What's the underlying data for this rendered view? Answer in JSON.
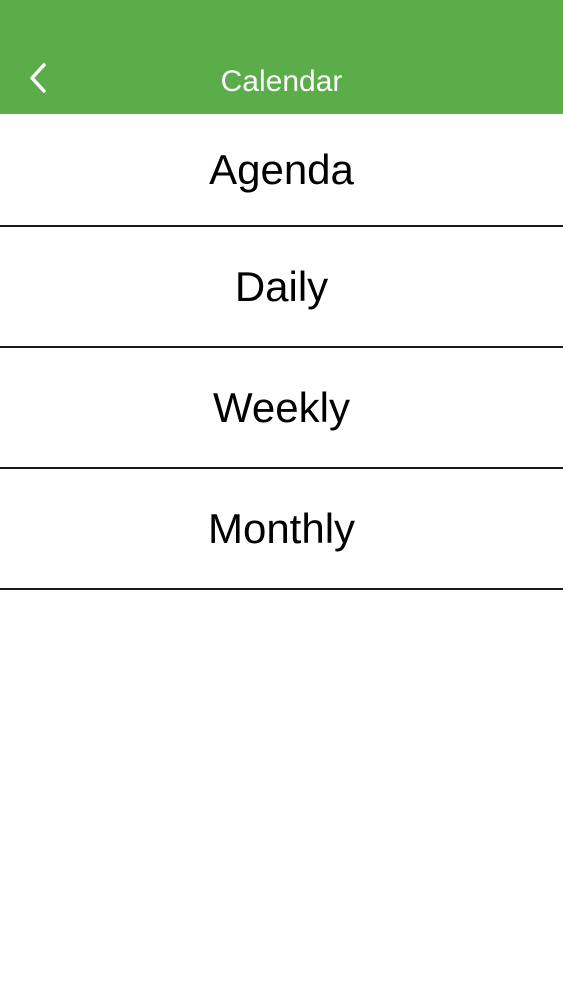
{
  "header": {
    "title": "Calendar",
    "back_icon": "chevron-left-icon",
    "background_color": "#5aad49"
  },
  "menu": {
    "items": [
      {
        "label": "Agenda"
      },
      {
        "label": "Daily"
      },
      {
        "label": "Weekly"
      },
      {
        "label": "Monthly"
      }
    ]
  }
}
